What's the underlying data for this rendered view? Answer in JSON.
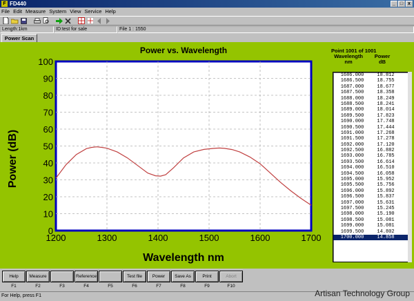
{
  "window": {
    "title": "FD440",
    "controls": [
      "_",
      "□",
      "x"
    ]
  },
  "menu": [
    "File",
    "Edit",
    "Measure",
    "System",
    "View",
    "Service",
    "Help"
  ],
  "toolbar": {
    "icons": [
      "new-file-icon",
      "open-folder-icon",
      "save-icon",
      "print-icon",
      "print-preview-icon",
      "go-arrow-icon",
      "stop-x-icon",
      "grid-icon",
      "marker-icon",
      "back-arrow-icon",
      "forward-arrow-icon"
    ]
  },
  "info": {
    "length": "Length:1km",
    "id": "ID:test for sale",
    "file": "File 1 : 1550"
  },
  "tab": "Power Scan",
  "chart_data": {
    "type": "line",
    "title": "Power vs. Wavelength",
    "xlabel": "Wavelength nm",
    "ylabel": "Power (dB)",
    "xlim": [
      1200,
      1700
    ],
    "ylim": [
      0,
      100
    ],
    "xticks": [
      "1200",
      "1300",
      "1400",
      "1500",
      "1600",
      "1700"
    ],
    "yticks": [
      "0",
      "10",
      "20",
      "30",
      "40",
      "50",
      "60",
      "70",
      "80",
      "90",
      "100"
    ],
    "grid": true,
    "series": [
      {
        "color": "#c04040",
        "x": [
          1200,
          1220,
          1240,
          1260,
          1270,
          1280,
          1290,
          1300,
          1320,
          1340,
          1360,
          1380,
          1395,
          1405,
          1415,
          1430,
          1450,
          1470,
          1490,
          1510,
          1520,
          1530,
          1545,
          1560,
          1580,
          1600,
          1620,
          1640,
          1660,
          1680,
          1700
        ],
        "y": [
          31,
          39,
          45,
          48.5,
          49.2,
          49.5,
          49.2,
          48.7,
          46.5,
          43,
          38.5,
          34,
          32.4,
          32.2,
          33,
          37,
          43,
          46.5,
          48,
          48.6,
          48.8,
          48.6,
          47.9,
          46.5,
          43.5,
          39.5,
          34,
          28.5,
          23.5,
          19,
          15
        ]
      }
    ]
  },
  "point_table": {
    "header": "Point 1001 of 1001",
    "col1": [
      "Wavelength",
      "nm"
    ],
    "col2": [
      "Power",
      "dB"
    ],
    "rows": [
      [
        "1686.000",
        "18.812"
      ],
      [
        "1686.500",
        "18.755"
      ],
      [
        "1687.000",
        "18.677"
      ],
      [
        "1687.500",
        "18.358"
      ],
      [
        "1688.000",
        "18.249"
      ],
      [
        "1688.500",
        "18.241"
      ],
      [
        "1689.000",
        "18.014"
      ],
      [
        "1689.500",
        "17.823"
      ],
      [
        "1690.000",
        "17.748"
      ],
      [
        "1690.500",
        "17.444"
      ],
      [
        "1691.000",
        "17.268"
      ],
      [
        "1691.500",
        "17.278"
      ],
      [
        "1692.000",
        "17.120"
      ],
      [
        "1692.500",
        "16.882"
      ],
      [
        "1693.000",
        "16.785"
      ],
      [
        "1693.500",
        "16.614"
      ],
      [
        "1694.000",
        "16.510"
      ],
      [
        "1694.500",
        "16.058"
      ],
      [
        "1695.000",
        "15.952"
      ],
      [
        "1695.500",
        "15.756"
      ],
      [
        "1696.000",
        "15.892"
      ],
      [
        "1696.500",
        "15.837"
      ],
      [
        "1697.000",
        "15.631"
      ],
      [
        "1697.500",
        "15.245"
      ],
      [
        "1698.000",
        "15.190"
      ],
      [
        "1698.500",
        "15.081"
      ],
      [
        "1699.000",
        "15.081"
      ],
      [
        "1699.500",
        "14.802"
      ],
      [
        "1700.000",
        "14.858"
      ]
    ],
    "selected_index": 28
  },
  "fkeys": [
    {
      "label": "Help",
      "key": "F1",
      "enabled": true
    },
    {
      "label": "Measure",
      "key": "F2",
      "enabled": true
    },
    {
      "label": "",
      "key": "F3",
      "enabled": true
    },
    {
      "label": "Reference",
      "key": "F4",
      "enabled": true
    },
    {
      "label": "",
      "key": "F5",
      "enabled": true
    },
    {
      "label": "Test file",
      "key": "F6",
      "enabled": true
    },
    {
      "label": "Power",
      "key": "F7",
      "enabled": true
    },
    {
      "label": "Save As",
      "key": "F8",
      "enabled": true
    },
    {
      "label": "Print",
      "key": "F9",
      "enabled": true
    },
    {
      "label": "Abort",
      "key": "F10",
      "enabled": false
    }
  ],
  "status": "For Help, press F1",
  "watermark": "Artisan Technology Group"
}
